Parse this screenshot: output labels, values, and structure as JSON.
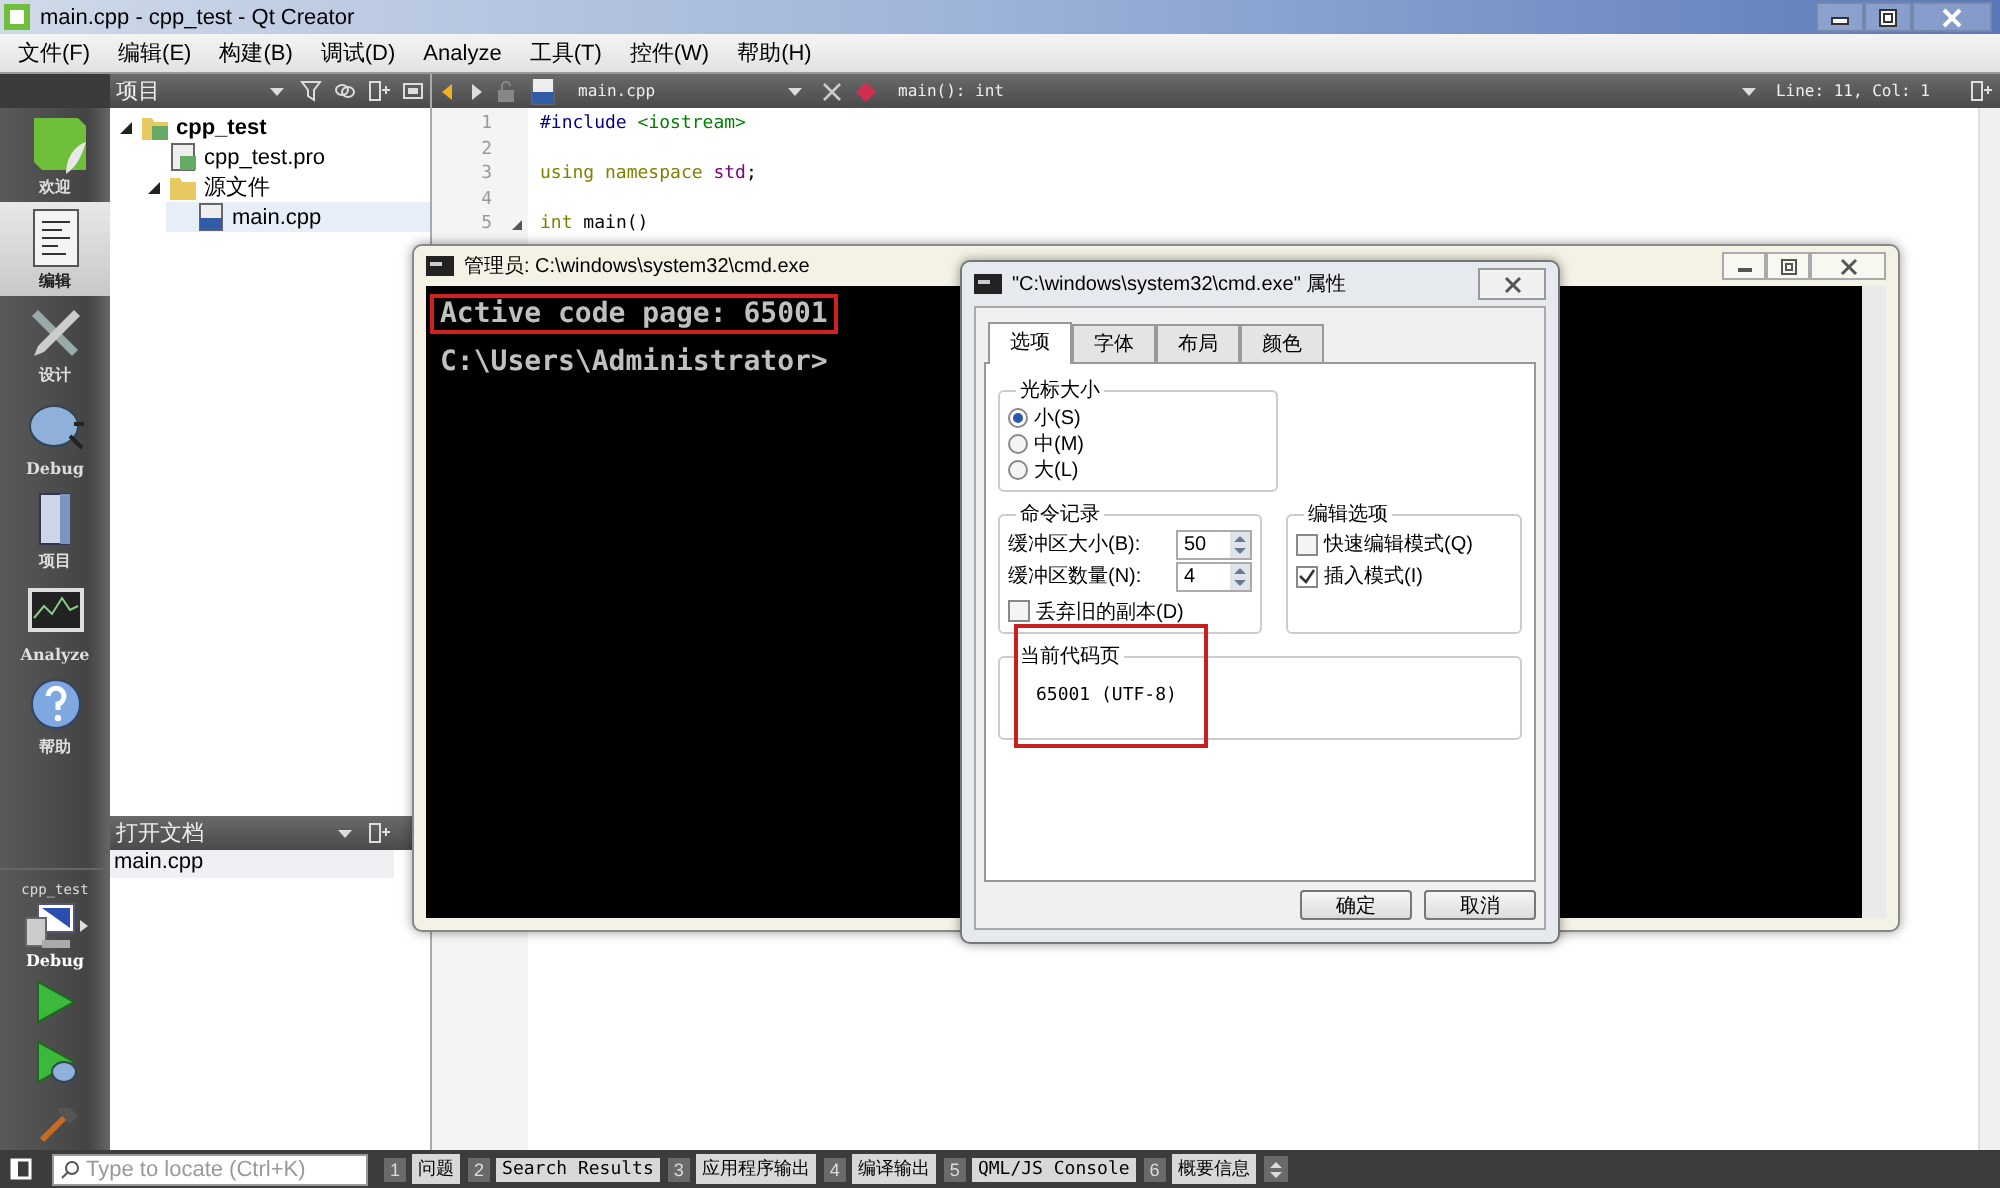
{
  "window": {
    "title": "main.cpp - cpp_test - Qt Creator"
  },
  "menu": [
    "文件(F)",
    "编辑(E)",
    "构建(B)",
    "调试(D)",
    "Analyze",
    "工具(T)",
    "控件(W)",
    "帮助(H)"
  ],
  "modes": [
    {
      "label": "欢迎",
      "selected": false
    },
    {
      "label": "编辑",
      "selected": true
    },
    {
      "label": "设计",
      "selected": false
    },
    {
      "label": "Debug",
      "selected": false
    },
    {
      "label": "项目",
      "selected": false
    },
    {
      "label": "Analyze",
      "selected": false
    },
    {
      "label": "帮助",
      "selected": false
    }
  ],
  "target": {
    "project": "cpp_test",
    "config": "Debug"
  },
  "project_pane": {
    "title": "项目",
    "tree": [
      {
        "label": "cpp_test",
        "kind": "project",
        "expanded": true,
        "selected": false,
        "children": [
          {
            "label": "cpp_test.pro",
            "kind": "project-file",
            "selected": false
          },
          {
            "label": "源文件",
            "kind": "folder",
            "expanded": true,
            "selected": false,
            "children": [
              {
                "label": "main.cpp",
                "kind": "source-file",
                "selected": true
              }
            ]
          }
        ]
      }
    ]
  },
  "open_docs": {
    "title": "打开文档",
    "items": [
      {
        "label": "main.cpp"
      }
    ]
  },
  "editor": {
    "file": "main.cpp",
    "symbol": "main(): int",
    "position": "Line: 11, Col: 1",
    "lines": [
      {
        "number": "1",
        "tokens": [
          {
            "text": "#include",
            "kind": "preproc"
          },
          {
            "text": " <iostream>",
            "kind": "string"
          }
        ]
      },
      {
        "number": "2"
      },
      {
        "number": "3",
        "tokens": [
          {
            "text": "using namespace",
            "kind": "keyword"
          },
          {
            "text": " std",
            "kind": "type"
          },
          {
            "text": ";"
          }
        ]
      },
      {
        "number": "4"
      },
      {
        "number": "5",
        "foldable": true,
        "tokens": [
          {
            "text": "int",
            "kind": "keyword"
          },
          {
            "text": " main()"
          }
        ]
      }
    ]
  },
  "locate": {
    "placeholder": "Type to locate (Ctrl+K)"
  },
  "output_tabs": [
    {
      "number": "1",
      "label": "问题"
    },
    {
      "number": "2",
      "label": "Search Results"
    },
    {
      "number": "3",
      "label": "应用程序输出"
    },
    {
      "number": "4",
      "label": "编译输出"
    },
    {
      "number": "5",
      "label": "QML/JS Console"
    },
    {
      "number": "6",
      "label": "概要信息"
    }
  ],
  "console": {
    "title": "管理员: C:\\windows\\system32\\cmd.exe",
    "lines": [
      {
        "text": "Active code page: 65001",
        "highlighted": true
      },
      {
        "text": "C:\\Users\\Administrator>",
        "highlighted": false
      }
    ]
  },
  "dialog": {
    "title": "\"C:\\windows\\system32\\cmd.exe\" 属性",
    "tabs": [
      {
        "label": "选项",
        "selected": true
      },
      {
        "label": "字体",
        "selected": false
      },
      {
        "label": "布局",
        "selected": false
      },
      {
        "label": "颜色",
        "selected": false
      }
    ],
    "cursor_size": {
      "title": "光标大小",
      "options": [
        {
          "label": "小(S)",
          "selected": true
        },
        {
          "label": "中(M)",
          "selected": false
        },
        {
          "label": "大(L)",
          "selected": false
        }
      ]
    },
    "history": {
      "title": "命令记录",
      "spinners": [
        {
          "label": "缓冲区大小(B):",
          "value": "50"
        },
        {
          "label": "缓冲区数量(N):",
          "value": "4"
        }
      ],
      "discard": {
        "label": "丢弃旧的副本(D)",
        "checked": false
      }
    },
    "edit_options": {
      "title": "编辑选项",
      "options": [
        {
          "label": "快速编辑模式(Q)",
          "checked": false
        },
        {
          "label": "插入模式(I)",
          "checked": true
        }
      ]
    },
    "code_page": {
      "title": "当前代码页",
      "value": "65001 (UTF-8)",
      "highlighted": true
    },
    "buttons": [
      "确定",
      "取消"
    ]
  }
}
